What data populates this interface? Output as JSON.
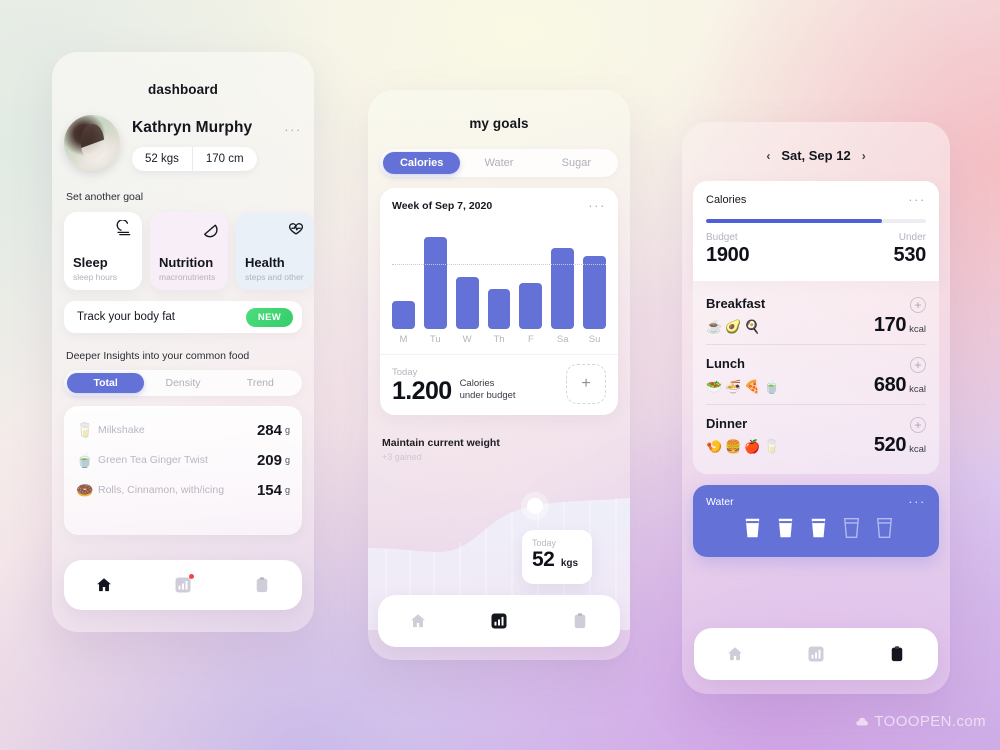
{
  "theme": {
    "accent": "#6471d6",
    "accent_dark": "#4f5fdb",
    "badge_green": "#3ad170",
    "text_dark": "#14161d",
    "text_muted": "#b5b3bf"
  },
  "phone1": {
    "title": "dashboard",
    "profile": {
      "name": "Kathryn Murphy",
      "weight": "52 kgs",
      "height": "170 cm",
      "menu": "···"
    },
    "goal_section_label": "Set another goal",
    "goal_cards": [
      {
        "name": "Sleep",
        "sub": "sleep hours",
        "icon": "moon-icon"
      },
      {
        "name": "Nutrition",
        "sub": "macronutrients",
        "icon": "watermelon-slice-icon"
      },
      {
        "name": "Health",
        "sub": "steps and other",
        "icon": "heart-pulse-icon"
      }
    ],
    "bodyfat": {
      "label": "Track your body fat",
      "badge": "NEW"
    },
    "insights_label": "Deeper Insights into your common food",
    "tabs": [
      {
        "label": "Total",
        "active": true
      },
      {
        "label": "Density",
        "active": false
      },
      {
        "label": "Trend",
        "active": false
      }
    ],
    "foods": [
      {
        "emoji": "🥛",
        "name": "Milkshake",
        "value": "284",
        "unit": "g"
      },
      {
        "emoji": "🍵",
        "name": "Green Tea Ginger Twist",
        "value": "209",
        "unit": "g"
      },
      {
        "emoji": "🍩",
        "name": "Rolls, Cinnamon, with/icing",
        "value": "154",
        "unit": "g"
      }
    ],
    "nav": [
      {
        "icon": "home-icon",
        "active": true,
        "badge": false
      },
      {
        "icon": "chart-icon",
        "active": false,
        "badge": true
      },
      {
        "icon": "clipboard-icon",
        "active": false,
        "badge": false
      }
    ]
  },
  "phone2": {
    "title": "my goals",
    "tabs": [
      {
        "label": "Calories",
        "active": true
      },
      {
        "label": "Water",
        "active": false
      },
      {
        "label": "Sugar",
        "active": false
      }
    ],
    "chart_card": {
      "title": "Week of Sep 7, 2020",
      "menu": "···",
      "today_label": "Today",
      "today_value": "1.200",
      "today_desc_line1": "Calories",
      "today_desc_line2": "under budget",
      "add_label": "+"
    },
    "weight": {
      "title": "Maintain current weight",
      "sub": "+3 gained",
      "bubble_label": "Today",
      "bubble_value": "52",
      "bubble_unit": "kgs"
    },
    "nav": [
      {
        "icon": "home-icon",
        "active": false,
        "badge": false
      },
      {
        "icon": "chart-icon",
        "active": true,
        "badge": false
      },
      {
        "icon": "clipboard-icon",
        "active": false,
        "badge": false
      }
    ]
  },
  "phone3": {
    "date": {
      "prev": "‹",
      "label": "Sat, Sep 12",
      "next": "›"
    },
    "calories": {
      "title": "Calories",
      "menu": "···",
      "progress_percent": 80,
      "budget_label": "Budget",
      "budget_value": "1900",
      "under_label": "Under",
      "under_value": "530"
    },
    "meals": [
      {
        "name": "Breakfast",
        "emojis": "☕🥑🍳",
        "kcal": "170",
        "unit": "kcal",
        "add": "+"
      },
      {
        "name": "Lunch",
        "emojis": "🥗🍜🍕🍵",
        "kcal": "680",
        "unit": "kcal",
        "add": "+"
      },
      {
        "name": "Dinner",
        "emojis": "🍤🍔🍎🥛",
        "kcal": "520",
        "unit": "kcal",
        "add": "+"
      }
    ],
    "water": {
      "title": "Water",
      "menu": "···",
      "glasses": [
        {
          "filled": true
        },
        {
          "filled": true
        },
        {
          "filled": true
        },
        {
          "filled": false
        },
        {
          "filled": false
        }
      ]
    },
    "nav": [
      {
        "icon": "home-icon",
        "active": false,
        "badge": false
      },
      {
        "icon": "chart-icon",
        "active": false,
        "badge": false
      },
      {
        "icon": "clipboard-icon",
        "active": true,
        "badge": false
      }
    ]
  },
  "chart_data": {
    "type": "bar",
    "title": "Week of Sep 7, 2020",
    "xlabel": "",
    "ylabel": "Calories",
    "categories": [
      "M",
      "Tu",
      "W",
      "Th",
      "F",
      "Sa",
      "Su"
    ],
    "values": [
      27,
      88,
      50,
      38,
      44,
      78,
      70
    ],
    "ylim": [
      0,
      100
    ],
    "goal_line": 62,
    "grid": false,
    "legend": "none",
    "bar_color": "#6471d6"
  },
  "watermark": "TOOOPEN.com"
}
